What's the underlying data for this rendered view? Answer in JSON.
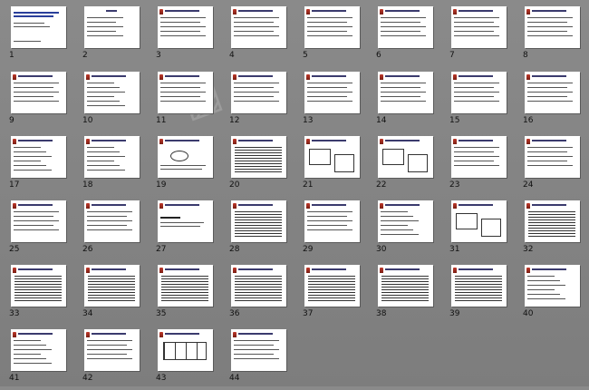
{
  "slide_sorter": {
    "slides": [
      {
        "number": "1",
        "layout": "title"
      },
      {
        "number": "2",
        "layout": "title2"
      },
      {
        "number": "3",
        "layout": "text"
      },
      {
        "number": "4",
        "layout": "text"
      },
      {
        "number": "5",
        "layout": "text"
      },
      {
        "number": "6",
        "layout": "text"
      },
      {
        "number": "7",
        "layout": "text"
      },
      {
        "number": "8",
        "layout": "text"
      },
      {
        "number": "9",
        "layout": "text"
      },
      {
        "number": "10",
        "layout": "bullets"
      },
      {
        "number": "11",
        "layout": "text"
      },
      {
        "number": "12",
        "layout": "text"
      },
      {
        "number": "13",
        "layout": "text"
      },
      {
        "number": "14",
        "layout": "text"
      },
      {
        "number": "15",
        "layout": "text"
      },
      {
        "number": "16",
        "layout": "text"
      },
      {
        "number": "17",
        "layout": "bullets"
      },
      {
        "number": "18",
        "layout": "bullets"
      },
      {
        "number": "19",
        "layout": "diagram"
      },
      {
        "number": "20",
        "layout": "dense"
      },
      {
        "number": "21",
        "layout": "boxes"
      },
      {
        "number": "22",
        "layout": "boxes"
      },
      {
        "number": "23",
        "layout": "text"
      },
      {
        "number": "24",
        "layout": "text"
      },
      {
        "number": "25",
        "layout": "text"
      },
      {
        "number": "26",
        "layout": "text"
      },
      {
        "number": "27",
        "layout": "heading"
      },
      {
        "number": "28",
        "layout": "dense"
      },
      {
        "number": "29",
        "layout": "text"
      },
      {
        "number": "30",
        "layout": "bullets"
      },
      {
        "number": "31",
        "layout": "boxes"
      },
      {
        "number": "32",
        "layout": "dense"
      },
      {
        "number": "33",
        "layout": "dense"
      },
      {
        "number": "34",
        "layout": "dense"
      },
      {
        "number": "35",
        "layout": "dense"
      },
      {
        "number": "36",
        "layout": "dense"
      },
      {
        "number": "37",
        "layout": "dense"
      },
      {
        "number": "38",
        "layout": "dense"
      },
      {
        "number": "39",
        "layout": "dense"
      },
      {
        "number": "40",
        "layout": "bullets"
      },
      {
        "number": "41",
        "layout": "bullets"
      },
      {
        "number": "42",
        "layout": "text"
      },
      {
        "number": "43",
        "layout": "table"
      },
      {
        "number": "44",
        "layout": "text"
      }
    ]
  }
}
